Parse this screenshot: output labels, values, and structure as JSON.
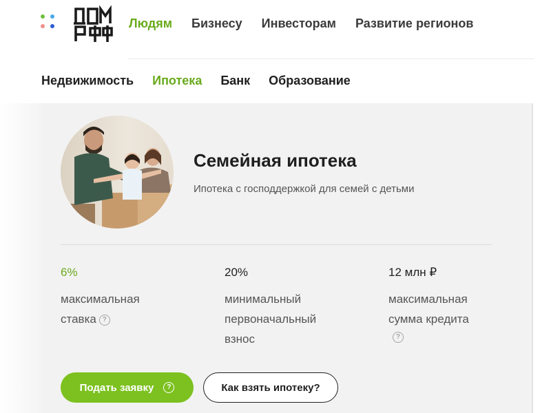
{
  "brand": {
    "logo_text": "ДОМ РФ",
    "dot_colors": [
      "#6fbf3d",
      "#4aa8e8",
      "#f0908a",
      "#2f5bd6"
    ]
  },
  "main_nav": [
    {
      "label": "Людям",
      "active": true
    },
    {
      "label": "Бизнесу",
      "active": false
    },
    {
      "label": "Инвесторам",
      "active": false
    },
    {
      "label": "Развитие регионов",
      "active": false
    }
  ],
  "sub_nav": [
    {
      "label": "Недвижимость",
      "active": false
    },
    {
      "label": "Ипотека",
      "active": true
    },
    {
      "label": "Банк",
      "active": false
    },
    {
      "label": "Образование",
      "active": false
    }
  ],
  "product": {
    "title": "Семейная ипотека",
    "subtitle": "Ипотека с господдержкой для семей с детьми",
    "stats": [
      {
        "value": "6%",
        "label_lines": [
          "максимальная",
          "ставка"
        ],
        "help": true
      },
      {
        "value": "20%",
        "label_lines": [
          "минимальный",
          "первоначальный",
          "взнос"
        ],
        "help": false
      },
      {
        "value": "12 млн ₽",
        "label_lines": [
          "максимальная",
          "сумма кредита"
        ],
        "help": true
      }
    ]
  },
  "buttons": {
    "apply_label": "Подать заявку",
    "how_label": "Как взять ипотеку?"
  },
  "icons": {
    "help": "?"
  },
  "colors": {
    "accent": "#6aaa1c",
    "button_green": "#7cc11f",
    "card_bg": "#f2f2f2"
  }
}
